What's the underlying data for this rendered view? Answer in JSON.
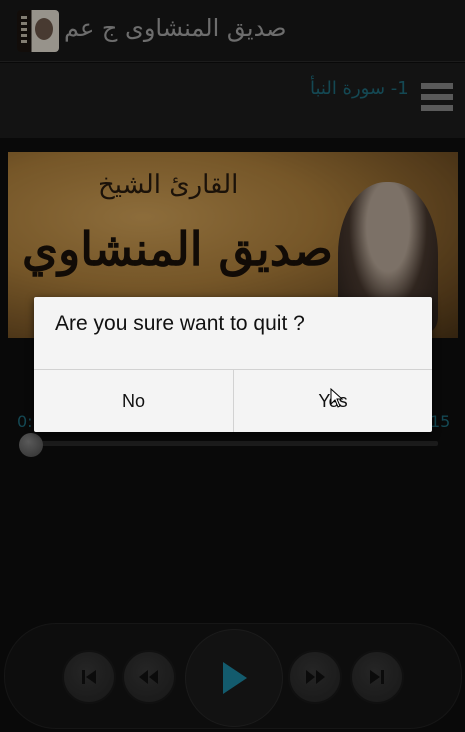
{
  "app": {
    "title": "صديق المنشاوى ج عم"
  },
  "player": {
    "track_title": "1- سورة النبأ",
    "time_elapsed": "0:",
    "time_total": "15",
    "progress": 0
  },
  "banner": {
    "line1": "القارئ الشيخ",
    "line2": "صديق المنشاوي"
  },
  "dialog": {
    "message": "Are you sure want to quit ?",
    "no_label": "No",
    "yes_label": "Yes"
  },
  "controls": {
    "icons": [
      "skip-previous-icon",
      "rewind-icon",
      "play-icon",
      "fast-forward-icon",
      "skip-next-icon"
    ]
  },
  "colors": {
    "accent": "#1f6f80",
    "play": "#1e8ca8"
  }
}
